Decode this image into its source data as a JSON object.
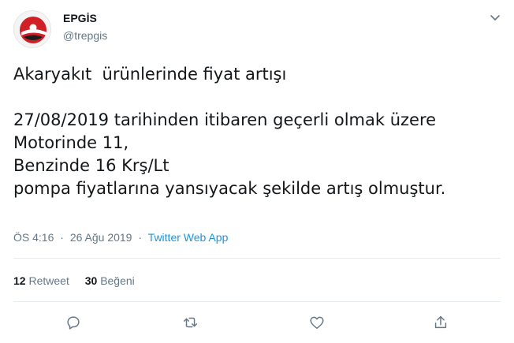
{
  "account": {
    "display_name": "EPGİS",
    "handle": "@trepgis"
  },
  "tweet": {
    "text": "Akaryakıt  ürünlerinde fiyat artışı\n\n27/08/2019 tarihinden itibaren geçerli olmak üzere\nMotorinde 11,\nBenzinde 16 Krş/Lt\npompa fiyatlarına yansıyacak şekilde artış olmuştur.",
    "time": "ÖS 4:16",
    "separator": "·",
    "date": "26 Ağu 2019",
    "source": "Twitter Web App"
  },
  "stats": {
    "retweets_count": "12",
    "retweets_label": "Retweet",
    "likes_count": "30",
    "likes_label": "Beğeni"
  },
  "icons": {
    "caret": "chevron-down-icon",
    "reply": "reply-icon",
    "retweet": "retweet-icon",
    "like": "heart-icon",
    "share": "share-icon"
  },
  "colors": {
    "brand_red": "#d11f26",
    "link_blue": "#1b95e0",
    "muted_gray": "#657786",
    "text": "#14171a"
  }
}
